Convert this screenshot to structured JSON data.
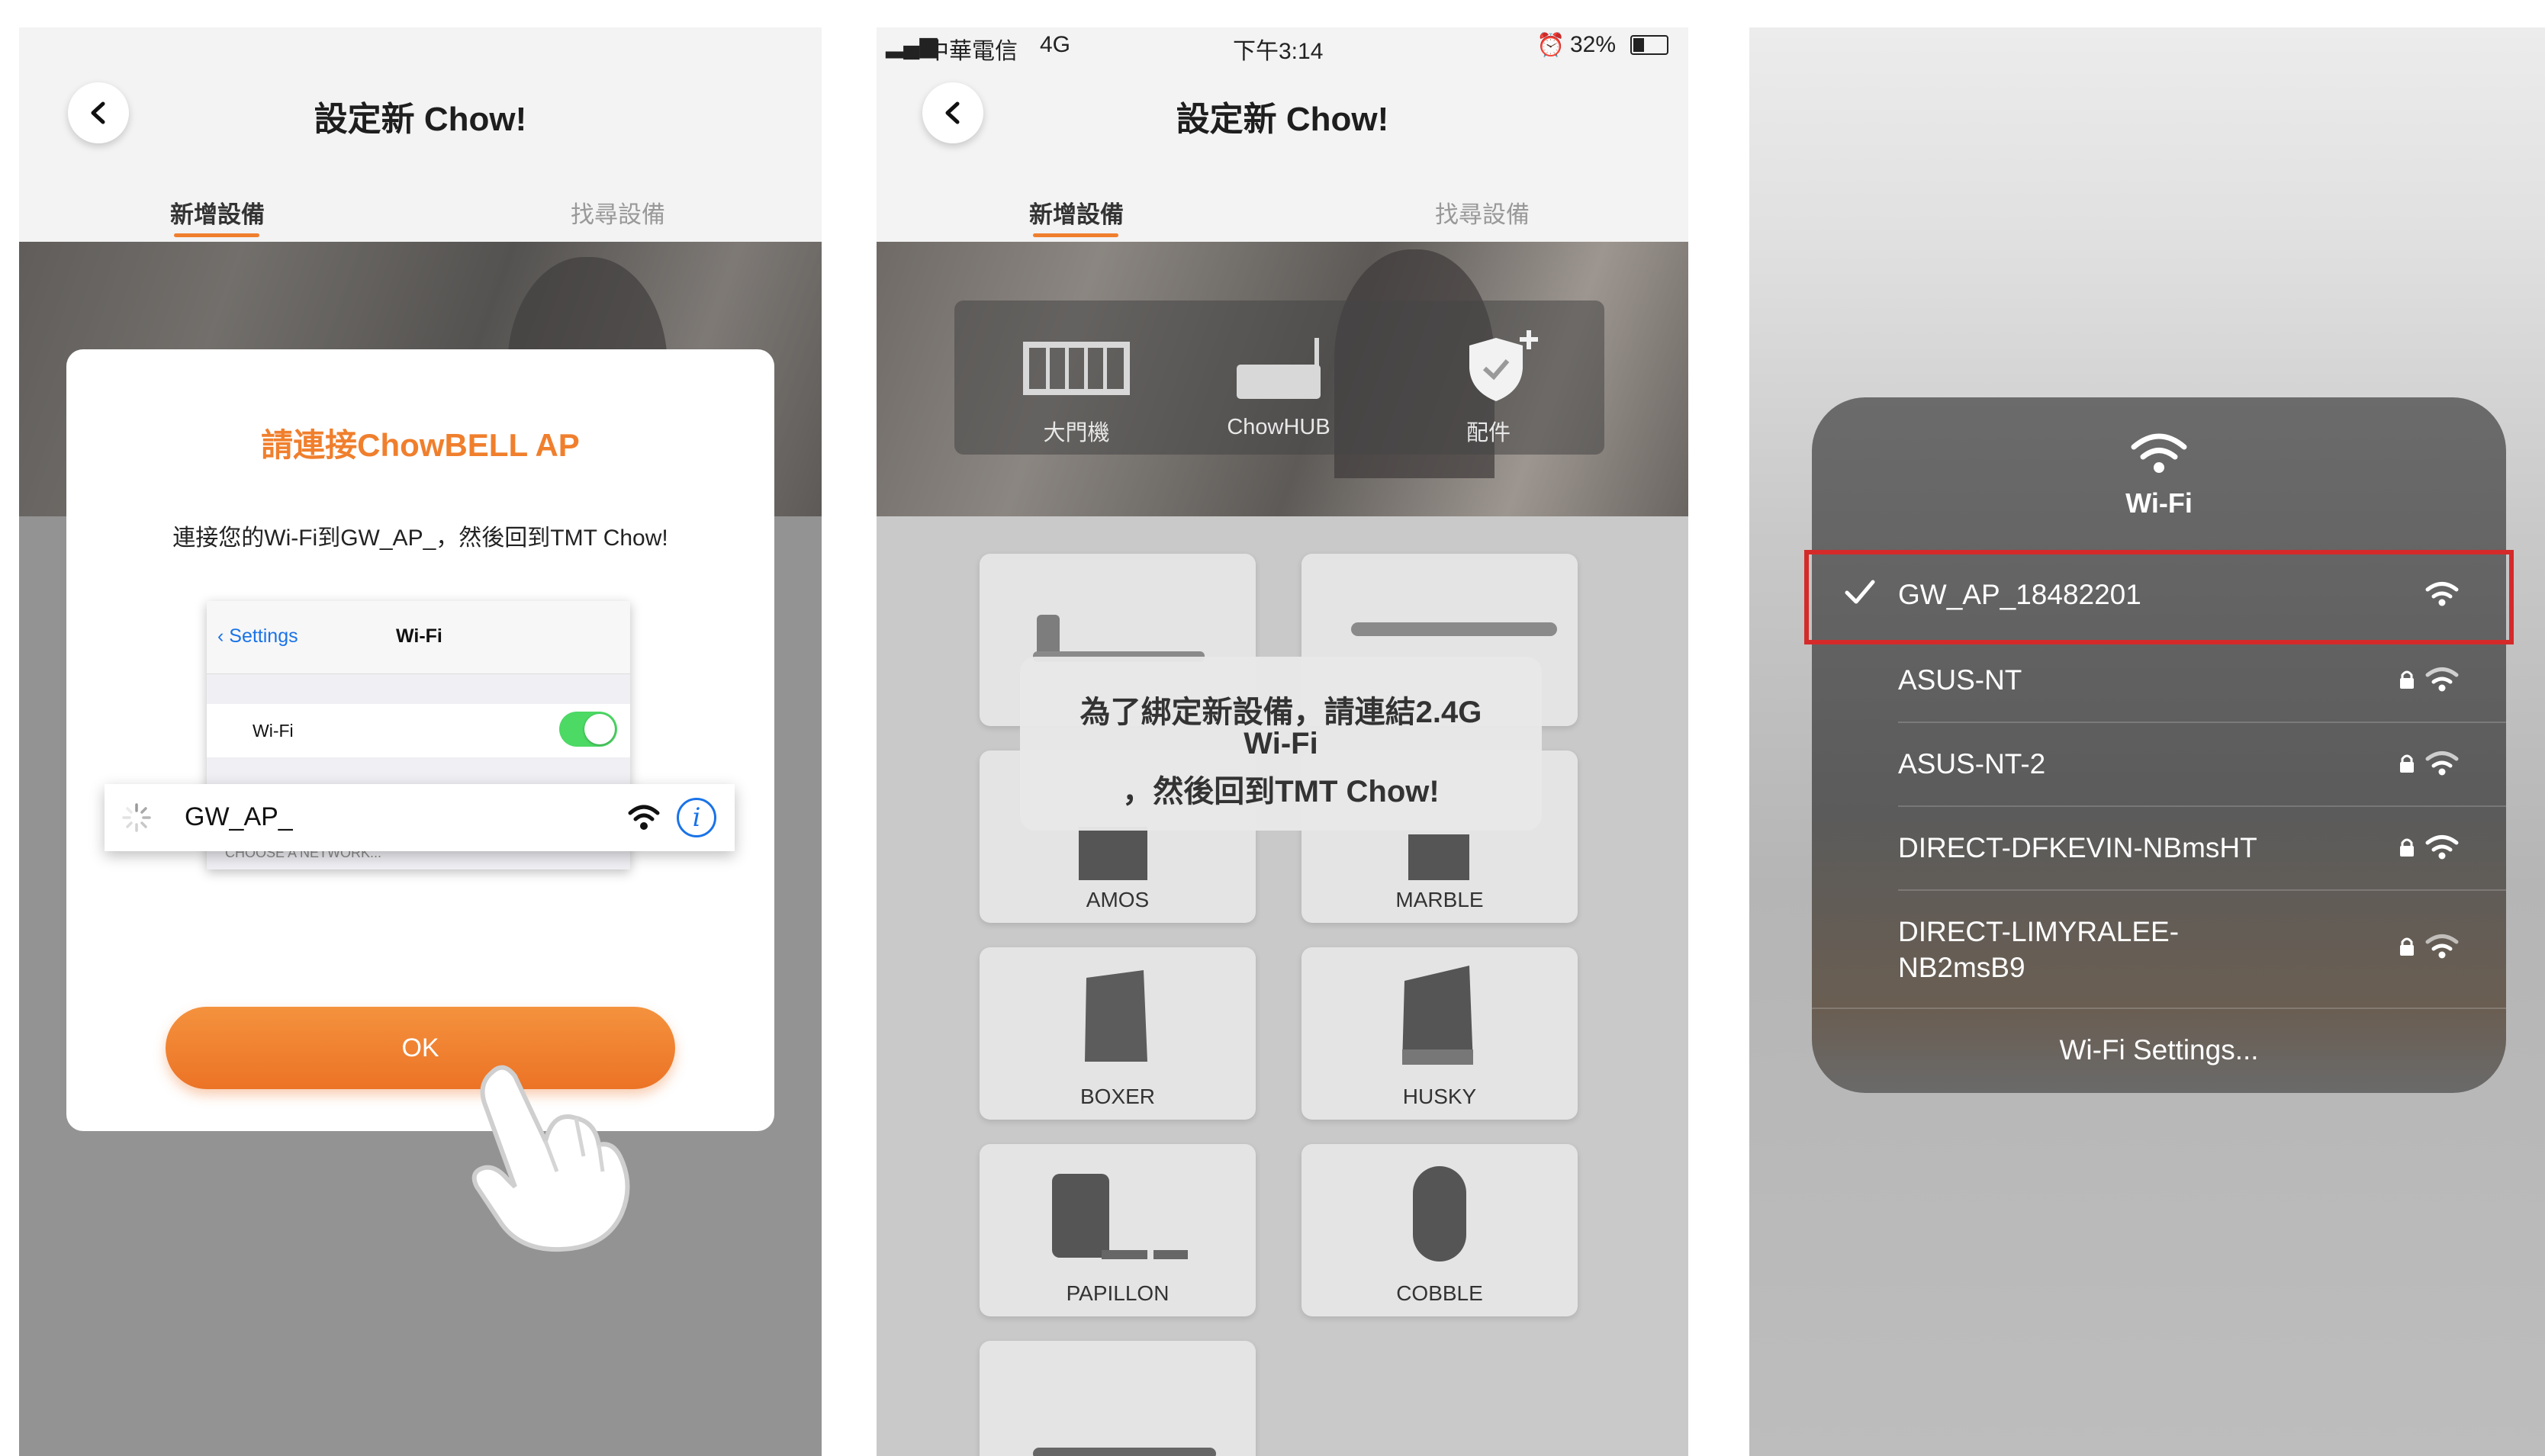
{
  "screen1": {
    "title": "設定新 Chow!",
    "tabs": [
      "新增設備",
      "找尋設備"
    ],
    "dialog": {
      "title": "請連接ChowBELL AP",
      "message": "連接您的Wi-Fi到GW_AP_，然後回到TMT Chow!",
      "ios_back_label": "Settings",
      "ios_nav_title": "Wi-Fi",
      "ios_wifi_label": "Wi-Fi",
      "ap_name": "GW_AP_",
      "choose_network_label": "CHOOSE A NETWORK...",
      "ok_label": "OK"
    }
  },
  "screen2": {
    "status": {
      "carrier": "中華電信",
      "network": "4G",
      "time": "下午3:14",
      "battery": "32%"
    },
    "title": "設定新 Chow!",
    "tabs": [
      "新增設備",
      "找尋設備"
    ],
    "device_types": [
      {
        "label": "大門機",
        "icon": "gate-icon"
      },
      {
        "label": "ChowHUB",
        "icon": "hub-icon"
      },
      {
        "label": "配件",
        "icon": "shield-plus-icon"
      }
    ],
    "models": [
      "AMOS",
      "MARBLE",
      "BOXER",
      "HUSKY",
      "PAPILLON",
      "COBBLE"
    ],
    "toast": {
      "line1": "為了綁定新設備，請連結2.4G",
      "line2": "Wi-Fi",
      "line3": "，然後回到TMT Chow!"
    }
  },
  "screen3": {
    "panel_title": "Wi-Fi",
    "networks": [
      {
        "name": "GW_AP_18482201",
        "locked": false,
        "selected": true
      },
      {
        "name": "ASUS-NT",
        "locked": true,
        "selected": false
      },
      {
        "name": "ASUS-NT-2",
        "locked": true,
        "selected": false
      },
      {
        "name": "DIRECT-DFKEVIN-NBmsHT",
        "locked": true,
        "selected": false
      },
      {
        "name": "DIRECT-LIMYRALEE-",
        "name_line2": "NB2msB9",
        "locked": true,
        "selected": false
      }
    ],
    "settings_label": "Wi-Fi Settings..."
  },
  "colors": {
    "accent": "#f07f2d",
    "highlight": "#d52a2a",
    "ios_blue": "#1a73e8",
    "toggle_on": "#4cd964"
  }
}
